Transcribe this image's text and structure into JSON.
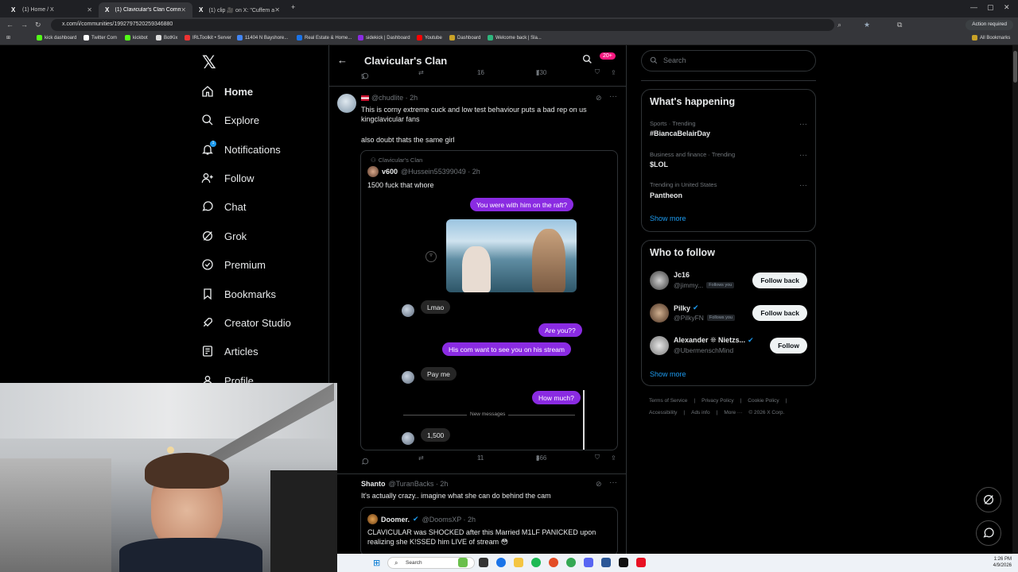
{
  "browser": {
    "tabs": [
      {
        "label": "(1) Home / X"
      },
      {
        "label": "(1) Clavicular's Clan Communi..."
      },
      {
        "label": "(1) clip 🎥 on X: \"Cuffem abou..."
      }
    ],
    "url": "x.com/i/communities/1992797520259346880",
    "action_required": "Action required",
    "bookmarks": [
      "kick dashboard",
      "Twitter Com",
      "kickbot",
      "BotKix",
      "IRLToolkit • Server",
      "11404 N Bayshore...",
      "Real Estate & Home...",
      "sidekick | Dashboard",
      "Youtube",
      "Dashboard",
      "Welcome back | Sla..."
    ],
    "all_bookmarks": "All Bookmarks"
  },
  "nav": {
    "items": [
      {
        "label": "Home",
        "icon": "home-icon"
      },
      {
        "label": "Explore",
        "icon": "search-icon"
      },
      {
        "label": "Notifications",
        "icon": "bell-icon",
        "badge": "1"
      },
      {
        "label": "Follow",
        "icon": "person-add-icon"
      },
      {
        "label": "Chat",
        "icon": "chat-icon"
      },
      {
        "label": "Grok",
        "icon": "grok-icon"
      },
      {
        "label": "Premium",
        "icon": "verified-icon"
      },
      {
        "label": "Bookmarks",
        "icon": "bookmark-icon"
      },
      {
        "label": "Creator Studio",
        "icon": "rocket-icon"
      },
      {
        "label": "Articles",
        "icon": "article-icon"
      },
      {
        "label": "Profile",
        "icon": "person-icon"
      }
    ]
  },
  "header": {
    "title": "Clavicular's Clan",
    "badge": "20+"
  },
  "top_actions": {
    "replies": "5",
    "reposts": "",
    "likes": "16",
    "views": "730"
  },
  "post1": {
    "handle": "@chudlite · 2h",
    "text1": "This is corny extreme cuck and low test behaviour puts a bad rep on us kingclavicular fans",
    "text2": "also doubt thats the same girl",
    "quote": {
      "community": "Clavicular's Clan",
      "name": "v600",
      "handle": "@Hussein55399049 · 2h",
      "text": "1500 fuck that whore"
    },
    "chat": {
      "m1": "You were with him on the raft?",
      "m2": "Lmao",
      "m3": "Are you??",
      "m4": "His com want to see you on his stream",
      "m5": "Pay me",
      "m6": "How much?",
      "divider": "New messages",
      "m7": "1,500"
    },
    "actions": {
      "reposts": "",
      "likes": "11",
      "views": "366"
    }
  },
  "post2": {
    "name": "Shanto",
    "handle": "@TuranBacks · 2h",
    "text": "It's actually crazy.. imagine what she can do behind the cam",
    "quote": {
      "name": "Doomer.",
      "handle": "@DoomsXP · 2h",
      "text": "CLAVICULAR was SHOCKED after this Married M1LF PANICKED upon realizing she K!SSED him LIVE of stream 😳"
    }
  },
  "right": {
    "search_placeholder": "Search",
    "whats_happening": "What's happening",
    "trends": [
      {
        "meta": "Sports · Trending",
        "name": "#BiancaBelairDay"
      },
      {
        "meta": "Business and finance · Trending",
        "name": "$LOL"
      },
      {
        "meta": "Trending in United States",
        "name": "Pantheon"
      }
    ],
    "show_more": "Show more",
    "who_to_follow": "Who to follow",
    "suggestions": [
      {
        "name": "Jc16",
        "handle": "@jimmy...",
        "follows_you": "Follows you",
        "button": "Follow back",
        "verified": false
      },
      {
        "name": "Pilky",
        "handle": "@PilkyFN",
        "follows_you": "Follows you",
        "button": "Follow back",
        "verified": true
      },
      {
        "name": "Alexander ❊ Nietzs...",
        "handle": "@UbermenschMind",
        "follows_you": "",
        "button": "Follow",
        "verified": true
      }
    ],
    "footer1": [
      "Terms of Service",
      "|",
      "Privacy Policy",
      "|",
      "Cookie Policy",
      "|"
    ],
    "footer2": [
      "Accessibility",
      "|",
      "Ads info",
      "|",
      "More ···",
      "© 2026 X Corp."
    ]
  },
  "taskbar": {
    "search": "Search",
    "time": "1:26 PM",
    "date": "4/9/2026"
  },
  "colors": {
    "accent": "#1d9bf0",
    "bubble_out": "#8a2be2",
    "badge": "#f91880"
  }
}
